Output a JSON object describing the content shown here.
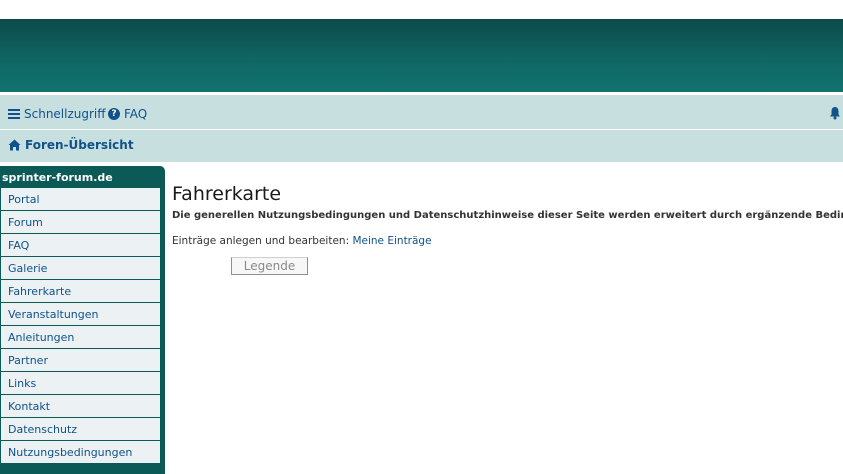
{
  "header": {
    "quick_access_label": "Schnellzugriff",
    "faq_label": "FAQ",
    "breadcrumb_label": "Foren-Übersicht"
  },
  "sidebar": {
    "title": "sprinter-forum.de",
    "items": [
      {
        "label": "Portal"
      },
      {
        "label": "Forum"
      },
      {
        "label": "FAQ"
      },
      {
        "label": "Galerie"
      },
      {
        "label": "Fahrerkarte"
      },
      {
        "label": "Veranstaltungen"
      },
      {
        "label": "Anleitungen"
      },
      {
        "label": "Partner"
      },
      {
        "label": "Links"
      },
      {
        "label": "Kontakt"
      },
      {
        "label": "Datenschutz"
      },
      {
        "label": "Nutzungsbedingungen"
      }
    ]
  },
  "main": {
    "title": "Fahrerkarte",
    "subtitle": "Die generellen Nutzungsbedingungen und Datenschutzhinweise dieser Seite werden erweitert durch ergänzende Bedingungen",
    "entries_prefix": "Einträge anlegen und bearbeiten:",
    "entries_link": "Meine Einträge",
    "legend_button": "Legende"
  },
  "colors": {
    "banner": "#0f6663",
    "navbar": "#c8dfe0",
    "link": "#105289",
    "sidebar": "#0c5a58"
  },
  "icons": [
    "bars-icon",
    "question-circle-icon",
    "bell-icon",
    "home-icon"
  ]
}
